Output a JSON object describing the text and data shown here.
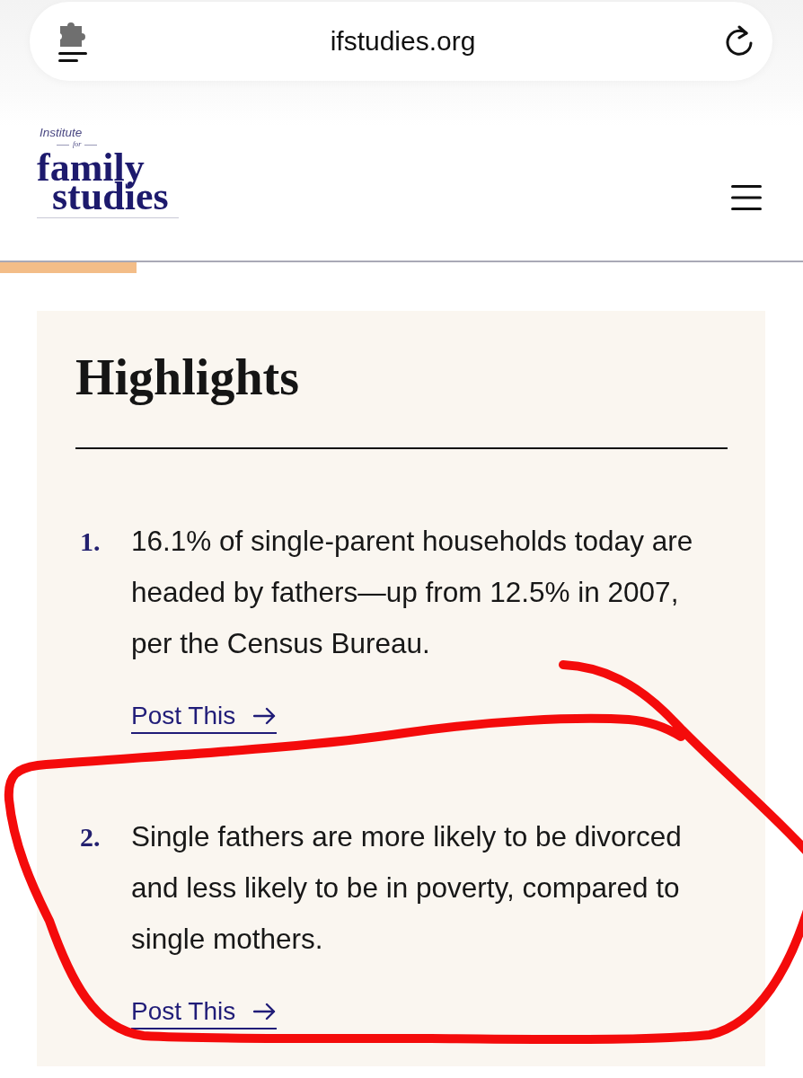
{
  "browser_bar": {
    "url": "ifstudies.org"
  },
  "header": {
    "logo": {
      "line_1": "Institute",
      "line_2": "for",
      "line_3": "family",
      "line_4": "studies"
    }
  },
  "reading_progress": {
    "level": 0.17
  },
  "highlights": {
    "title": "Highlights",
    "items": [
      {
        "number": "1.",
        "text": "16.1% of single-parent households today are headed by fathers—up from 12.5% in 2007, per the Census Bureau.",
        "link": "Post This"
      },
      {
        "number": "2.",
        "text": "Single fathers are more likely to be divorced and less likely to be in poverty, compared to single mothers.",
        "link": "Post This"
      }
    ]
  },
  "annotations": [
    {
      "kind": "freehand-loop"
    }
  ]
}
